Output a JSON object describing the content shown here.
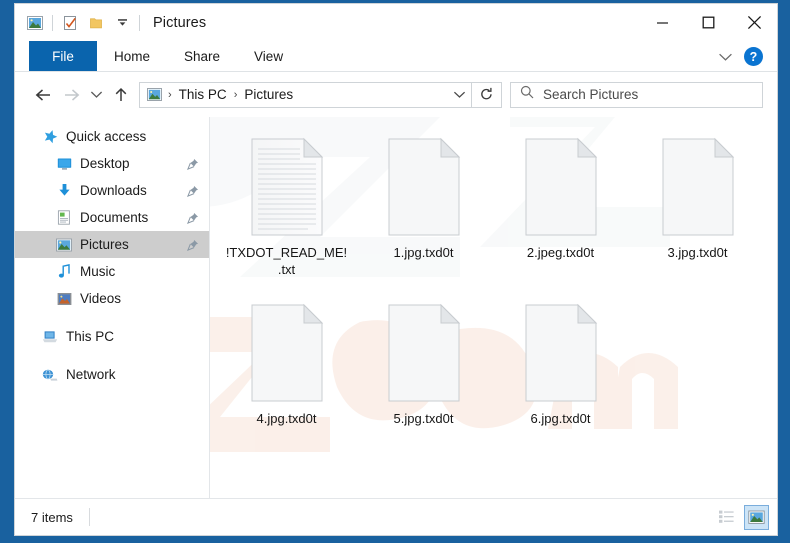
{
  "window": {
    "title": "Pictures",
    "quick_access_toolbar": [
      {
        "name": "pictures-folder-icon",
        "label": "Pictures"
      },
      {
        "name": "properties-icon",
        "label": "Properties"
      },
      {
        "name": "new-folder-icon",
        "label": "New folder"
      },
      {
        "name": "customize-dropdown-icon",
        "label": "Customize Quick Access Toolbar"
      }
    ],
    "controls": {
      "minimize": "Minimize",
      "maximize": "Maximize",
      "close": "Close"
    }
  },
  "ribbon": {
    "tabs": [
      {
        "label": "File",
        "active": true
      },
      {
        "label": "Home",
        "active": false
      },
      {
        "label": "Share",
        "active": false
      },
      {
        "label": "View",
        "active": false
      }
    ],
    "expand_label": "Expand the Ribbon",
    "help_label": "?"
  },
  "navbar": {
    "back_label": "Back",
    "forward_label": "Forward",
    "recent_label": "Recent locations",
    "up_label": "Up",
    "breadcrumbs": [
      {
        "label": "This PC"
      },
      {
        "label": "Pictures"
      }
    ],
    "separator": "›",
    "dropdown_label": "Previous locations",
    "refresh_label": "Refresh",
    "address_icon": "pictures-folder-icon"
  },
  "search": {
    "placeholder": "Search Pictures",
    "value": "",
    "icon": "search-icon"
  },
  "sidebar": {
    "groups": [
      {
        "header": {
          "label": "Quick access",
          "icon": "star-icon"
        },
        "items": [
          {
            "label": "Desktop",
            "icon": "desktop-icon",
            "pinned": true,
            "selected": false
          },
          {
            "label": "Downloads",
            "icon": "downloads-icon",
            "pinned": true,
            "selected": false
          },
          {
            "label": "Documents",
            "icon": "documents-icon",
            "pinned": true,
            "selected": false
          },
          {
            "label": "Pictures",
            "icon": "pictures-icon",
            "pinned": true,
            "selected": true
          },
          {
            "label": "Music",
            "icon": "music-icon",
            "pinned": false,
            "selected": false
          },
          {
            "label": "Videos",
            "icon": "videos-icon",
            "pinned": false,
            "selected": false
          }
        ]
      },
      {
        "header": {
          "label": "This PC",
          "icon": "this-pc-icon"
        },
        "items": []
      },
      {
        "header": {
          "label": "Network",
          "icon": "network-icon"
        },
        "items": []
      }
    ]
  },
  "files": [
    {
      "name": "!TXDOT_READ_ME!.txt",
      "icon": "text-file-icon",
      "type": "txt"
    },
    {
      "name": "1.jpg.txd0t",
      "icon": "blank-file-icon",
      "type": "txd0t"
    },
    {
      "name": "2.jpeg.txd0t",
      "icon": "blank-file-icon",
      "type": "txd0t"
    },
    {
      "name": "3.jpg.txd0t",
      "icon": "blank-file-icon",
      "type": "txd0t"
    },
    {
      "name": "4.jpg.txd0t",
      "icon": "blank-file-icon",
      "type": "txd0t"
    },
    {
      "name": "5.jpg.txd0t",
      "icon": "blank-file-icon",
      "type": "txd0t"
    },
    {
      "name": "6.jpg.txd0t",
      "icon": "blank-file-icon",
      "type": "txd0t"
    }
  ],
  "statusbar": {
    "item_count": "7 items",
    "views": [
      {
        "name": "details-view-button",
        "label": "Details view",
        "active": false
      },
      {
        "name": "large-icons-view-button",
        "label": "Large icons view",
        "active": true
      }
    ]
  },
  "colors": {
    "desktop": "#19619f",
    "accent": "#0a64ad",
    "selection": "#cdcdcd",
    "help_badge": "#0a74d1",
    "view_active_bg": "#cce4f7"
  },
  "watermark": {
    "text_top": "pcrisk",
    "text_bottom": "risk.com"
  }
}
